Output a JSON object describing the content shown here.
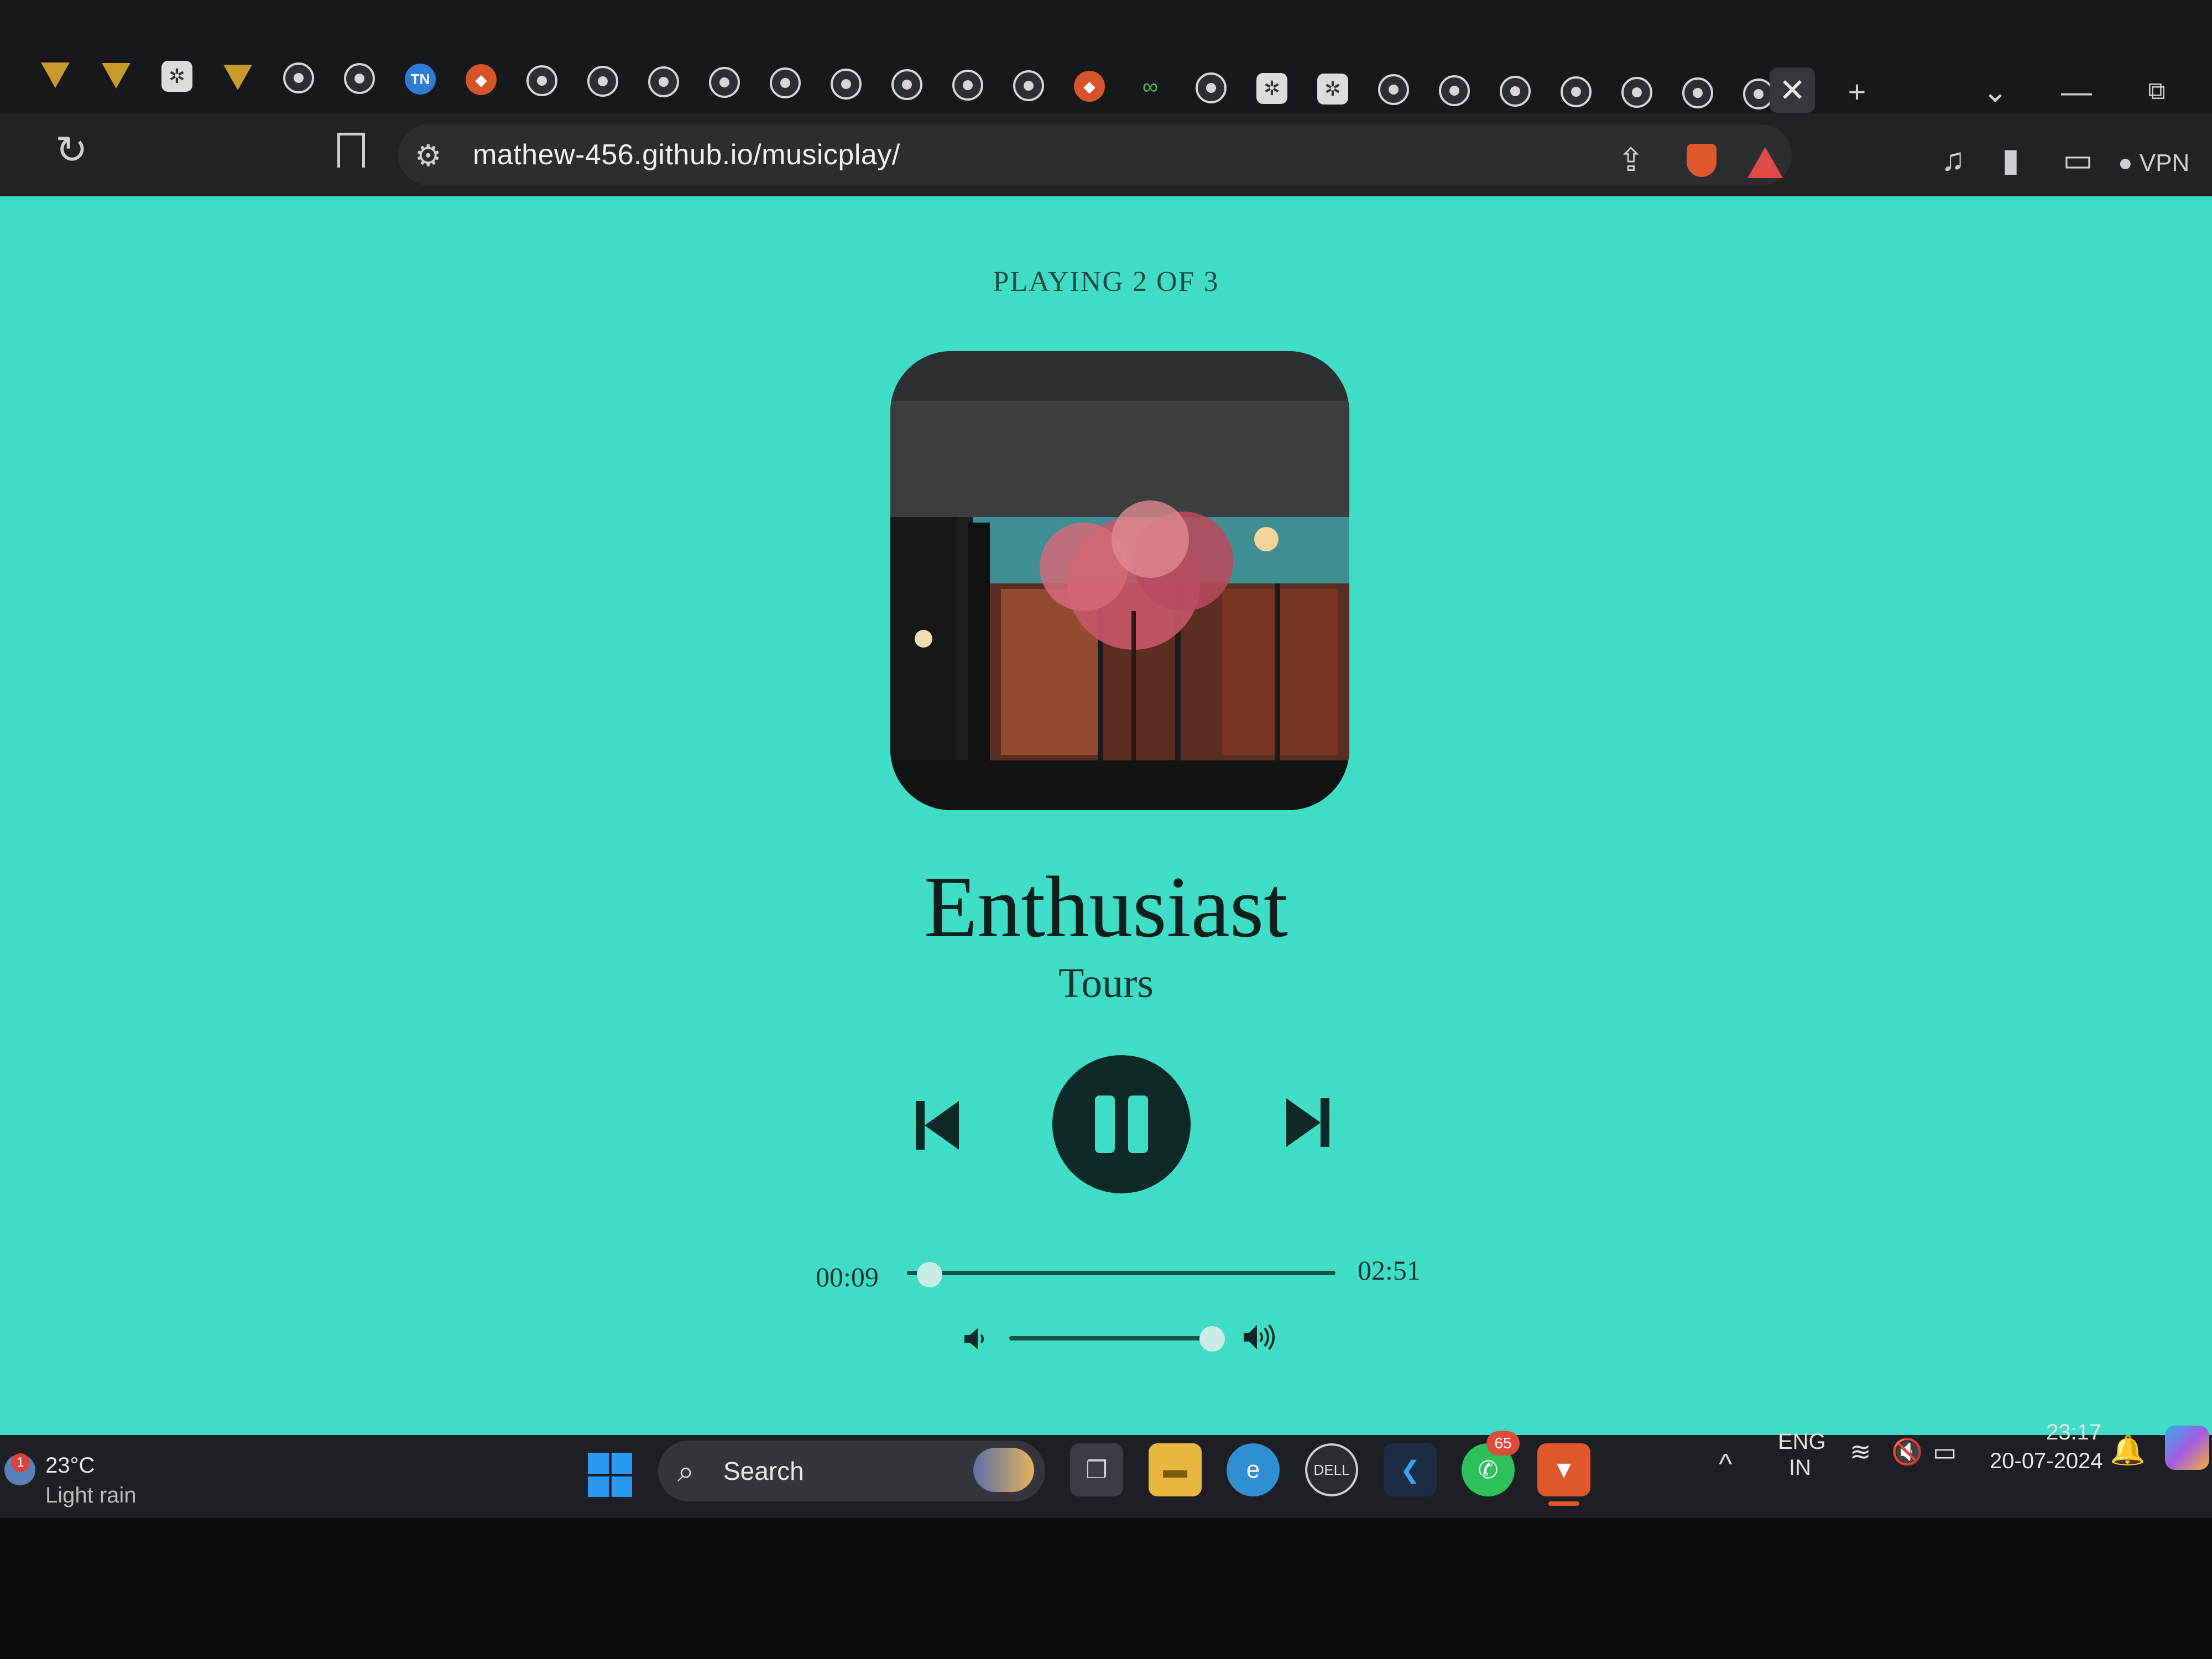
{
  "browser": {
    "tab_icons": [
      "vivaldi-icon",
      "vivaldi-icon",
      "chatgpt-icon",
      "vivaldi-icon",
      "globe-icon",
      "globe-icon",
      "tn-icon",
      "brave-shield-icon",
      "globe-icon",
      "globe-icon",
      "globe-icon",
      "globe-icon",
      "globe-icon",
      "globe-icon",
      "globe-icon",
      "globe-icon",
      "globe-icon",
      "brave-shield-icon",
      "green-link-icon",
      "globe-icon",
      "chatgpt-icon",
      "chatgpt-icon",
      "globe-icon",
      "globe-icon",
      "globe-icon",
      "globe-icon",
      "globe-icon",
      "globe-icon",
      "globe-icon"
    ],
    "active_tab_close": "✕",
    "new_tab": "+",
    "window_controls": {
      "tab_search": "⌄",
      "minimize": "—",
      "restore": "⧉"
    },
    "reload_icon": "↻",
    "tune_icon": "⚙",
    "url": "mathew-456.github.io/musicplay/",
    "share_icon": "⇪",
    "toolbar_icons": {
      "music": "♫",
      "sidebar": "▮",
      "wallet": "▭"
    },
    "vpn_label": "● VPN"
  },
  "player": {
    "playing_status": "PLAYING 2 OF 3",
    "song_title": "Enthusiast",
    "artist": "Tours",
    "current_time": "00:09",
    "total_time": "02:51",
    "progress_fraction": 0.053,
    "volume_fraction": 0.94,
    "is_playing": true,
    "accent_color": "#3fdcc6",
    "button_color": "#0f2a26",
    "cover_icon": "album-cover-image"
  },
  "taskbar": {
    "weather": {
      "badge": "1",
      "temperature": "23°C",
      "description": "Light rain"
    },
    "search_placeholder": "Search",
    "apps": [
      "task-view-icon",
      "file-explorer-icon",
      "edge-icon",
      "dell-icon",
      "vscode-icon",
      "whatsapp-icon",
      "brave-icon"
    ],
    "app_glyphs": {
      "taskview": "❐",
      "files": "▬",
      "edge": "e",
      "dell": "DELL",
      "vscode": "❮",
      "whatsapp": "✆",
      "brave": "▼"
    },
    "whatsapp_badge": "65",
    "tray": {
      "chevron": "^",
      "lang_line1": "ENG",
      "lang_line2": "IN",
      "wifi": "≋",
      "mute": "🔇",
      "battery": "▭"
    },
    "clock_time": "23:17",
    "clock_date": "20-07-2024",
    "bell": "🔔"
  }
}
